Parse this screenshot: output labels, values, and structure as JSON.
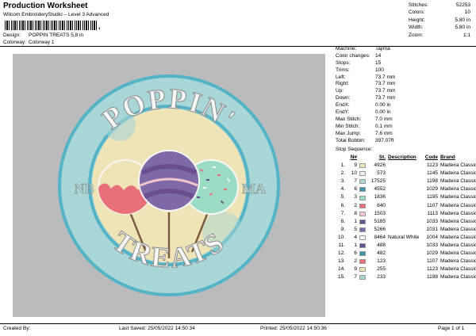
{
  "header": {
    "title": "Production Worksheet",
    "subtitle": "Wilcom EmbroideryStudio – Level 3 Advanced",
    "barcode_tail": ",",
    "design_label": "Design:",
    "design_value": "POPPIN TREATS 5,8 in",
    "colorway_label": "Colorway:",
    "colorway_value": "Colorway 1"
  },
  "stats": [
    {
      "k": "Stitches:",
      "v": "52253"
    },
    {
      "k": "Colors:",
      "v": "10"
    },
    {
      "k": "Height:",
      "v": "5.80 in"
    },
    {
      "k": "Width:",
      "v": "5.80 in"
    },
    {
      "k": "Zoom:",
      "v": "1:1"
    }
  ],
  "design": {
    "top_text": "POPPIN'",
    "bottom_text": "TREATS",
    "left_text": "NB",
    "right_text": "MA"
  },
  "info": [
    {
      "k": "Machine:",
      "v": "Tajima"
    },
    {
      "k": "Color changes:",
      "v": "14"
    },
    {
      "k": "Stops:",
      "v": "15"
    },
    {
      "k": "Trims:",
      "v": "100"
    },
    {
      "k": "Left:",
      "v": "73.7 mm"
    },
    {
      "k": "Right:",
      "v": "73.7 mm"
    },
    {
      "k": "Up:",
      "v": "73.7 mm"
    },
    {
      "k": "Down:",
      "v": "73.7 mm"
    },
    {
      "k": "EndX:",
      "v": "0.00 in"
    },
    {
      "k": "EndY:",
      "v": "0.00 in"
    },
    {
      "k": "Max Stitch:",
      "v": "7.0 mm"
    },
    {
      "k": "Min Stitch:",
      "v": "0.1 mm"
    },
    {
      "k": "Max Jump:",
      "v": "7.6 mm"
    },
    {
      "k": "Total Bobbin:",
      "v": "397.07ft"
    }
  ],
  "sequence": {
    "title": "Stop Sequence:",
    "headers": {
      "n": "N#",
      "st": "St.",
      "desc": "Description",
      "code": "Code",
      "brand": "Brand"
    },
    "rows": [
      {
        "idx": "1.",
        "n": "9",
        "color": "#efe4b6",
        "st": "4926",
        "desc": "",
        "code": "1123",
        "brand": "Madeira Classic 40"
      },
      {
        "idx": "2.",
        "n": "10",
        "color": "#f0f0f0",
        "st": "573",
        "desc": "",
        "code": "1145",
        "brand": "Madeira Classic 40"
      },
      {
        "idx": "3.",
        "n": "7",
        "color": "#a9d6d6",
        "st": "17525",
        "desc": "",
        "code": "1198",
        "brand": "Madeira Classic 40"
      },
      {
        "idx": "4.",
        "n": "6",
        "color": "#3a96ad",
        "st": "4552",
        "desc": "",
        "code": "1029",
        "brand": "Madeira Classic 40"
      },
      {
        "idx": "5.",
        "n": "3",
        "color": "#9bdcc4",
        "st": "1836",
        "desc": "",
        "code": "1195",
        "brand": "Madeira Classic 40"
      },
      {
        "idx": "6.",
        "n": "2",
        "color": "#e8707a",
        "st": "840",
        "desc": "",
        "code": "1107",
        "brand": "Madeira Classic 40"
      },
      {
        "idx": "7.",
        "n": "8",
        "color": "#f4c4cc",
        "st": "1503",
        "desc": "",
        "code": "1113",
        "brand": "Madeira Classic 40"
      },
      {
        "idx": "8.",
        "n": "1",
        "color": "#6a4f90",
        "st": "5185",
        "desc": "",
        "code": "1033",
        "brand": "Madeira Classic 40"
      },
      {
        "idx": "9.",
        "n": "5",
        "color": "#7d6aa6",
        "st": "5266",
        "desc": "",
        "code": "1031",
        "brand": "Madeira Classic 40"
      },
      {
        "idx": "10.",
        "n": "4",
        "color": "#f7f7f7",
        "st": "8464",
        "desc": "Natural White",
        "code": "1004",
        "brand": "Madeira Classic 40"
      },
      {
        "idx": "11.",
        "n": "1",
        "color": "#6a4f90",
        "st": "488",
        "code": "1033",
        "desc": "",
        "brand": "Madeira Classic 40"
      },
      {
        "idx": "12.",
        "n": "6",
        "color": "#3a96ad",
        "st": "482",
        "desc": "",
        "code": "1029",
        "brand": "Madeira Classic 40"
      },
      {
        "idx": "13.",
        "n": "2",
        "color": "#e8707a",
        "st": "123",
        "desc": "",
        "code": "1107",
        "brand": "Madeira Classic 40"
      },
      {
        "idx": "14.",
        "n": "9",
        "color": "#efe4b6",
        "st": "255",
        "desc": "",
        "code": "1123",
        "brand": "Madeira Classic 40"
      },
      {
        "idx": "15.",
        "n": "7",
        "color": "#a9d6d6",
        "st": "233",
        "desc": "",
        "code": "1198",
        "brand": "Madeira Classic 40"
      }
    ]
  },
  "footer": {
    "created": "Created By:",
    "saved": "Last Saved: 25/05/2022 14:50:34",
    "printed": "Printed: 25/05/2022 14:50:36",
    "page": "Page 1 of 1"
  }
}
